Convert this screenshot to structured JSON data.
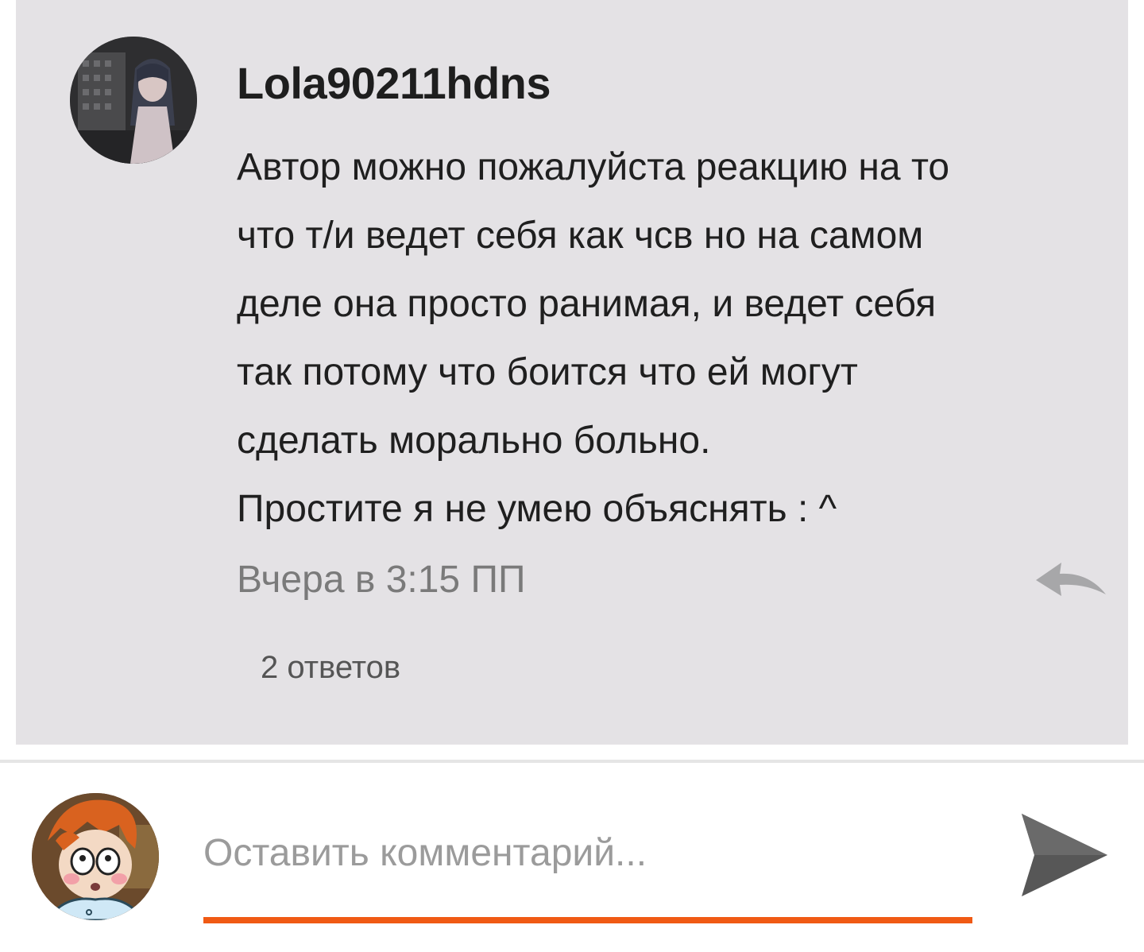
{
  "comment": {
    "username": "Lola90211hdns",
    "text": "Автор можно пожалуйста реакцию на то\nчто т/и ведет себя как чсв но на самом\nделе она просто ранимая, и ведет себя\nтак потому что боится что ей могут\nсделать морально больно.\nПростите я не умею объяснять : ^",
    "timestamp": "Вчера в 3:15 ПП",
    "replies_label": "2 ответов",
    "reply_icon": "reply-arrow-icon"
  },
  "composer": {
    "placeholder": "Оставить комментарий...",
    "value": "",
    "send_icon": "send-icon",
    "accent_color": "#f05a14"
  },
  "colors": {
    "card_background": "#e4e2e5",
    "text_primary": "#1f1f1f",
    "text_secondary": "#7a7a7a"
  }
}
